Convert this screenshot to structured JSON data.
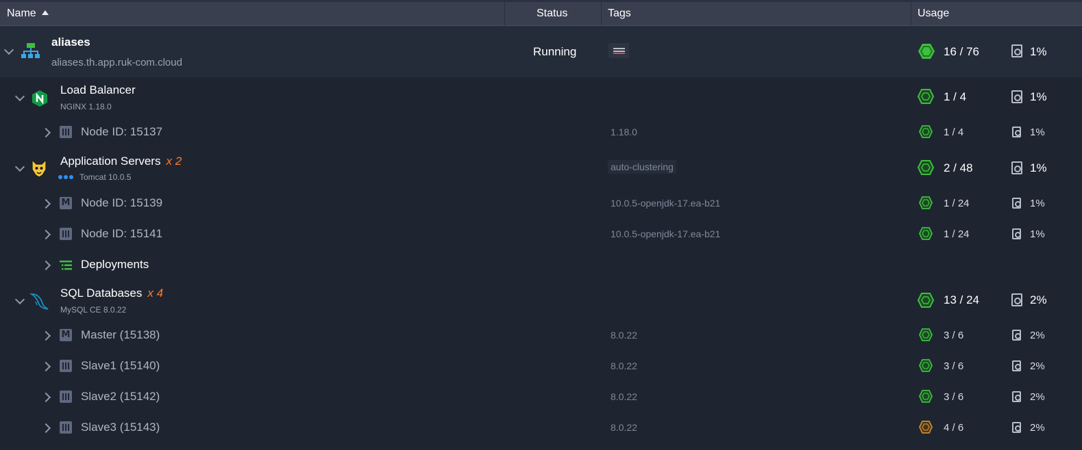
{
  "header": {
    "name_label": "Name",
    "status_label": "Status",
    "tags_label": "Tags",
    "usage_label": "Usage"
  },
  "environment": {
    "name": "aliases",
    "domain": "aliases.th.app.ruk-com.cloud",
    "status": "Running",
    "cloudlets": "16 / 76",
    "disk": "1%"
  },
  "load_balancer": {
    "name": "Load Balancer",
    "version": "NGINX 1.18.0",
    "cloudlets": "1 / 4",
    "disk": "1%",
    "nodes": [
      {
        "label": "Node ID: 15137",
        "tag": "1.18.0",
        "cloudlets": "1 / 4",
        "disk": "1%"
      }
    ]
  },
  "app_servers": {
    "name": "Application Servers",
    "multiplier": "x 2",
    "version": "Tomcat 10.0.5",
    "tag": "auto-clustering",
    "cloudlets": "2 / 48",
    "disk": "1%",
    "nodes": [
      {
        "label": "Node ID: 15139",
        "badge": "M",
        "tag": "10.0.5-openjdk-17.ea-b21",
        "cloudlets": "1 / 24",
        "disk": "1%"
      },
      {
        "label": "Node ID: 15141",
        "tag": "10.0.5-openjdk-17.ea-b21",
        "cloudlets": "1 / 24",
        "disk": "1%"
      }
    ],
    "deployments_label": "Deployments"
  },
  "sql_databases": {
    "name": "SQL Databases",
    "multiplier": "x 4",
    "version": "MySQL CE 8.0.22",
    "cloudlets": "13 / 24",
    "disk": "2%",
    "nodes": [
      {
        "label": "Master (15138)",
        "badge": "M",
        "tag": "8.0.22",
        "cloudlets": "3 / 6",
        "disk": "2%"
      },
      {
        "label": "Slave1 (15140)",
        "tag": "8.0.22",
        "cloudlets": "3 / 6",
        "disk": "2%"
      },
      {
        "label": "Slave2 (15142)",
        "tag": "8.0.22",
        "cloudlets": "3 / 6",
        "disk": "2%"
      },
      {
        "label": "Slave3 (15143)",
        "tag": "8.0.22",
        "cloudlets": "4 / 6",
        "disk": "2%"
      }
    ]
  },
  "icons": {
    "sort": "sort-ascending-icon",
    "cloudlet_normal_color": "#3fbf3f",
    "cloudlet_warning_color": "#c98a2e",
    "nginx_color": "#119c46",
    "env_color": "#3aa8e8",
    "env_top_color": "#3fbf3f",
    "deploy_color": "#3fbf3f",
    "mysql_color": "#1f8fc0"
  }
}
